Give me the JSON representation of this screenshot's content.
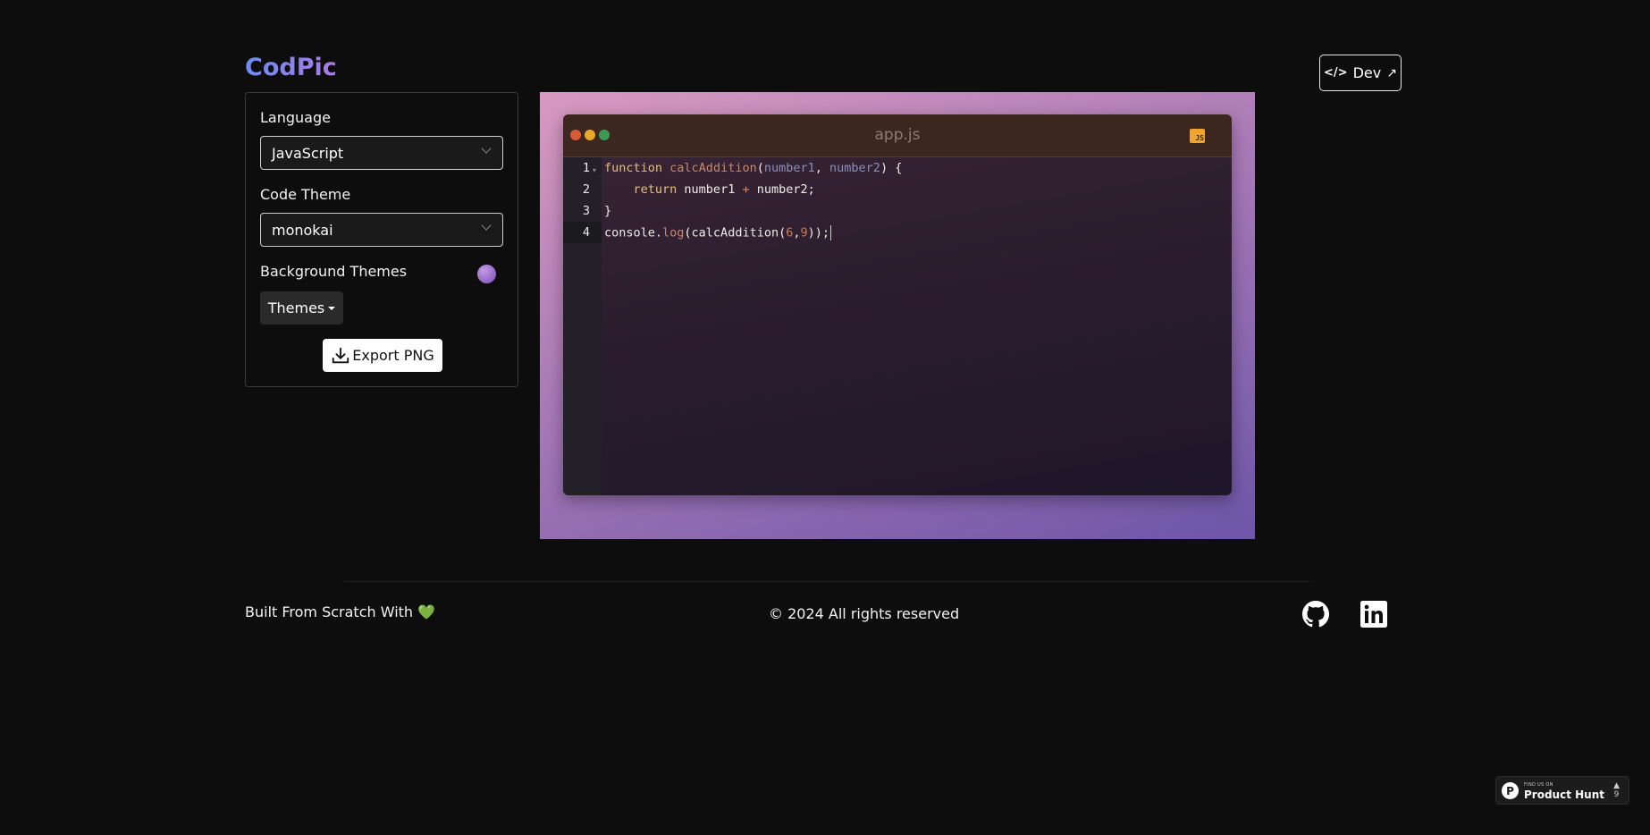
{
  "header": {
    "brand": "CodPic",
    "dev_label": "Dev"
  },
  "controls": {
    "language_label": "Language",
    "language_value": "JavaScript",
    "theme_label": "Code Theme",
    "theme_value": "monokai",
    "bg_label": "Background Themes",
    "themes_button": "Themes",
    "export_button": "Export PNG"
  },
  "editor": {
    "filename": "app.js",
    "file_icon_text": "JS",
    "line_numbers": [
      "1",
      "2",
      "3",
      "4"
    ],
    "lines": [
      "function calcAddition(number1, number2) {",
      "    return number1 + number2;",
      "}",
      "console.log(calcAddition(6,9));"
    ],
    "dot_colors": [
      "#d75b3b",
      "#e6a92d",
      "#3a9b55"
    ],
    "canvas_gradient": [
      "#d999c0",
      "#a87ab7",
      "#6d55a8"
    ]
  },
  "footer": {
    "built_text": "Built From Scratch With",
    "heart": "💚",
    "copyright": "© 2024 All rights reserved"
  },
  "badge": {
    "small": "FIND US ON",
    "big": "Product Hunt",
    "count": "9",
    "letter": "P"
  }
}
